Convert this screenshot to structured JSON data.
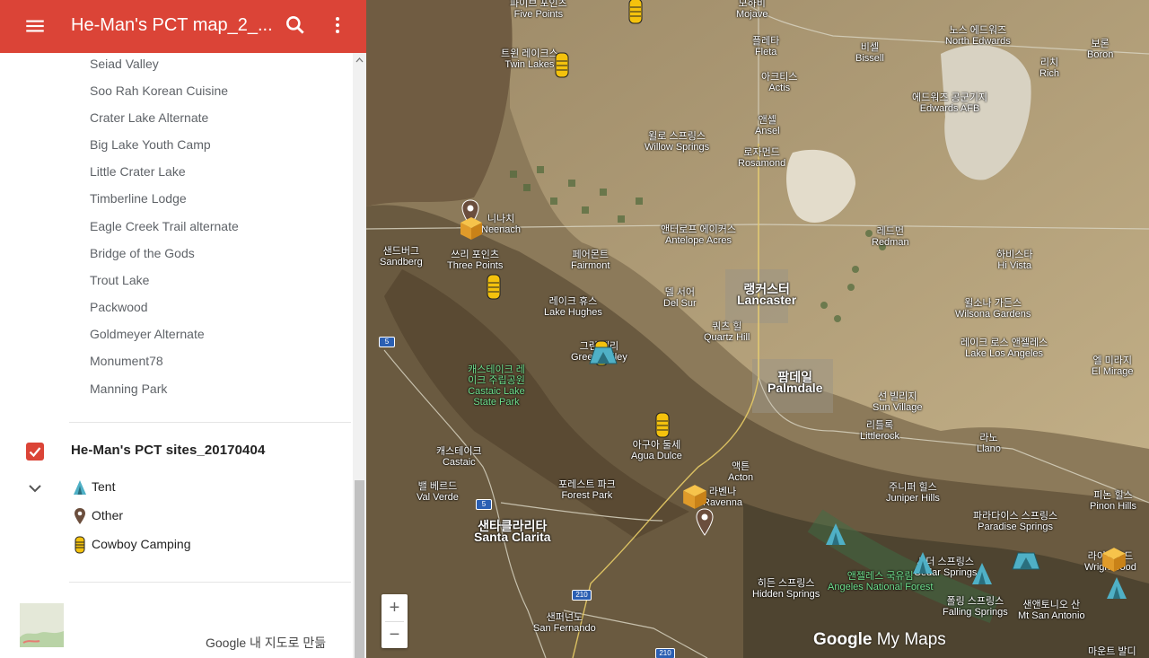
{
  "app": {
    "title": "He-Man's PCT map_2_...",
    "credit": "Google 내 지도로 만듦"
  },
  "places": [
    "Seiad Valley",
    "Soo Rah Korean Cuisine",
    "Crater Lake Alternate",
    "Big Lake Youth Camp",
    "Little Crater Lake",
    "Timberline Lodge",
    "Eagle Creek Trail alternate",
    "Bridge of the Gods",
    "Trout Lake",
    "Packwood",
    "Goldmeyer Alternate",
    "Monument78",
    "Manning Park"
  ],
  "layer": {
    "title": "He-Man's PCT sites_20170404",
    "checked": true,
    "legend": [
      {
        "label": "Tent",
        "icon": "tent-icon"
      },
      {
        "label": "Other",
        "icon": "pin-icon"
      },
      {
        "label": "Cowboy Camping",
        "icon": "sleeping-bag-icon"
      }
    ]
  },
  "map": {
    "labels": [
      {
        "ko": "파이브 포인츠",
        "en": "Five Points"
      },
      {
        "ko": "모하비",
        "en": "Mojave"
      },
      {
        "ko": "노스 에드워즈",
        "en": "North Edwards"
      },
      {
        "ko": "트윈 레이크스",
        "en": "Twin Lakes"
      },
      {
        "ko": "플레타",
        "en": "Fleta"
      },
      {
        "ko": "비셀",
        "en": "Bissell"
      },
      {
        "ko": "보론",
        "en": "Boron"
      },
      {
        "ko": "아크티스",
        "en": "Actis"
      },
      {
        "ko": "리치",
        "en": "Rich"
      },
      {
        "ko": "에드워즈 공군기지",
        "en": "Edwards AFB"
      },
      {
        "ko": "앤셀",
        "en": "Ansel"
      },
      {
        "ko": "윌로 스프링스",
        "en": "Willow Springs"
      },
      {
        "ko": "로자먼드",
        "en": "Rosamond"
      },
      {
        "ko": "니나치",
        "en": "Neenach"
      },
      {
        "ko": "앤터로프 에이커스",
        "en": "Antelope Acres"
      },
      {
        "ko": "레드먼",
        "en": "Redman"
      },
      {
        "ko": "샌드버그",
        "en": "Sandberg"
      },
      {
        "ko": "쓰리 포인츠",
        "en": "Three Points"
      },
      {
        "ko": "페어몬트",
        "en": "Fairmont"
      },
      {
        "ko": "하비스타",
        "en": "Hi Vista"
      },
      {
        "ko": "레이크 휴스",
        "en": "Lake Hughes"
      },
      {
        "ko": "델 서어",
        "en": "Del Sur"
      },
      {
        "ko": "랭커스터",
        "en": "Lancaster"
      },
      {
        "ko": "윌소나 가든스",
        "en": "Wilsona Gardens"
      },
      {
        "ko": "쿼츠 힐",
        "en": "Quartz Hill"
      },
      {
        "ko": "그린 밸리",
        "en": "Green Valley"
      },
      {
        "ko": "레이크 로스 앤젤레스",
        "en": "Lake Los Angeles"
      },
      {
        "ko": "엘 미라지",
        "en": "El Mirage"
      },
      {
        "ko": "캐스테이크 레이크 주립공원",
        "en": "Castaic Lake State Park"
      },
      {
        "ko": "팜데일",
        "en": "Palmdale"
      },
      {
        "ko": "선 빌리지",
        "en": "Sun Village"
      },
      {
        "ko": "리틀록",
        "en": "Littlerock"
      },
      {
        "ko": "캐스테이크",
        "en": "Castaic"
      },
      {
        "ko": "아구아 둘세",
        "en": "Agua Dulce"
      },
      {
        "ko": "라노",
        "en": "Llano"
      },
      {
        "ko": "액튼",
        "en": "Acton"
      },
      {
        "ko": "밸 베르드",
        "en": "Val Verde"
      },
      {
        "ko": "포레스트 파크",
        "en": "Forest Park"
      },
      {
        "ko": "라벤나",
        "en": "Ravenna"
      },
      {
        "ko": "주니퍼 힐스",
        "en": "Juniper Hills"
      },
      {
        "ko": "피논 힐스",
        "en": "Pinon Hills"
      },
      {
        "ko": "샌타클라리타",
        "en": "Santa Clarita"
      },
      {
        "ko": "파라다이스 스프링스",
        "en": "Paradise Springs"
      },
      {
        "ko": "시더 스프링스",
        "en": "Cedar Springs"
      },
      {
        "ko": "라이트우드",
        "en": "Wrightwood"
      },
      {
        "ko": "앤젤레스 국유림",
        "en": "Angeles National Forest"
      },
      {
        "ko": "히든 스프링스",
        "en": "Hidden Springs"
      },
      {
        "ko": "폴링 스프링스",
        "en": "Falling Springs"
      },
      {
        "ko": "샌앤토니오 산",
        "en": "Mt San Antonio"
      },
      {
        "ko": "샌퍼넌도",
        "en": "San Fernando"
      },
      {
        "ko": "마운트 발디",
        "en": ""
      }
    ],
    "highways": [
      "5",
      "5",
      "210",
      "210"
    ],
    "logo": {
      "google": "Google",
      "suffix": "My Maps"
    }
  },
  "colors": {
    "header": "#db4437",
    "tent": "#4fb0c6",
    "pin": "#6b4e3d",
    "cowboy": "#f4c20d",
    "box": "#f0a830"
  }
}
